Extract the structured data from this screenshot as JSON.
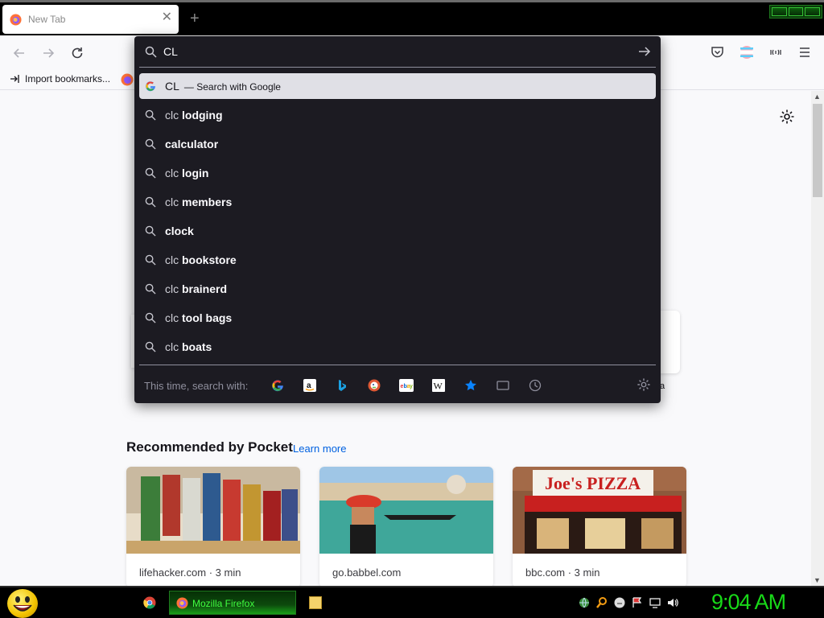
{
  "tab": {
    "title": "New Tab",
    "close": "✕",
    "new_tab": "+"
  },
  "bookmarks": {
    "import_label": "Import bookmarks..."
  },
  "urlbar": {
    "input_value": "CL",
    "results": [
      {
        "plain": "CL",
        "bold": "",
        "action": "— Search with Google",
        "selected": true,
        "icon": "google-icon"
      },
      {
        "plain": "clc ",
        "bold": "lodging",
        "action": "",
        "selected": false,
        "icon": "search-icon"
      },
      {
        "plain": "",
        "bold": "calculator",
        "action": "",
        "selected": false,
        "icon": "search-icon"
      },
      {
        "plain": "clc ",
        "bold": "login",
        "action": "",
        "selected": false,
        "icon": "search-icon"
      },
      {
        "plain": "clc ",
        "bold": "members",
        "action": "",
        "selected": false,
        "icon": "search-icon"
      },
      {
        "plain": "",
        "bold": "clock",
        "action": "",
        "selected": false,
        "icon": "search-icon"
      },
      {
        "plain": "clc ",
        "bold": "bookstore",
        "action": "",
        "selected": false,
        "icon": "search-icon"
      },
      {
        "plain": "clc ",
        "bold": "brainerd",
        "action": "",
        "selected": false,
        "icon": "search-icon"
      },
      {
        "plain": "clc ",
        "bold": "tool bags",
        "action": "",
        "selected": false,
        "icon": "search-icon"
      },
      {
        "plain": "clc ",
        "bold": "boats",
        "action": "",
        "selected": false,
        "icon": "search-icon"
      }
    ],
    "oneoff_label": "This time, search with:",
    "oneoffs": [
      "google-icon",
      "amazon-icon",
      "bing-icon",
      "duckduckgo-icon",
      "ebay-icon",
      "wikipedia-icon",
      "bookmarks-star-icon",
      "tabs-icon",
      "history-icon"
    ]
  },
  "pocket": {
    "heading": "Recommended by Pocket",
    "learn_more": "Learn more",
    "cards": [
      {
        "source": "lifehacker.com · 3 min"
      },
      {
        "source": "go.babbel.com"
      },
      {
        "source": "bbc.com · 3 min"
      }
    ]
  },
  "shortcut_label_fragment": "a",
  "taskbar": {
    "firefox_label": "Mozilla Firefox",
    "clock": "9:04 AM"
  },
  "colors": {
    "accent": "#0061e0",
    "popup_bg": "#1c1b22",
    "clock_green": "#18d918"
  }
}
